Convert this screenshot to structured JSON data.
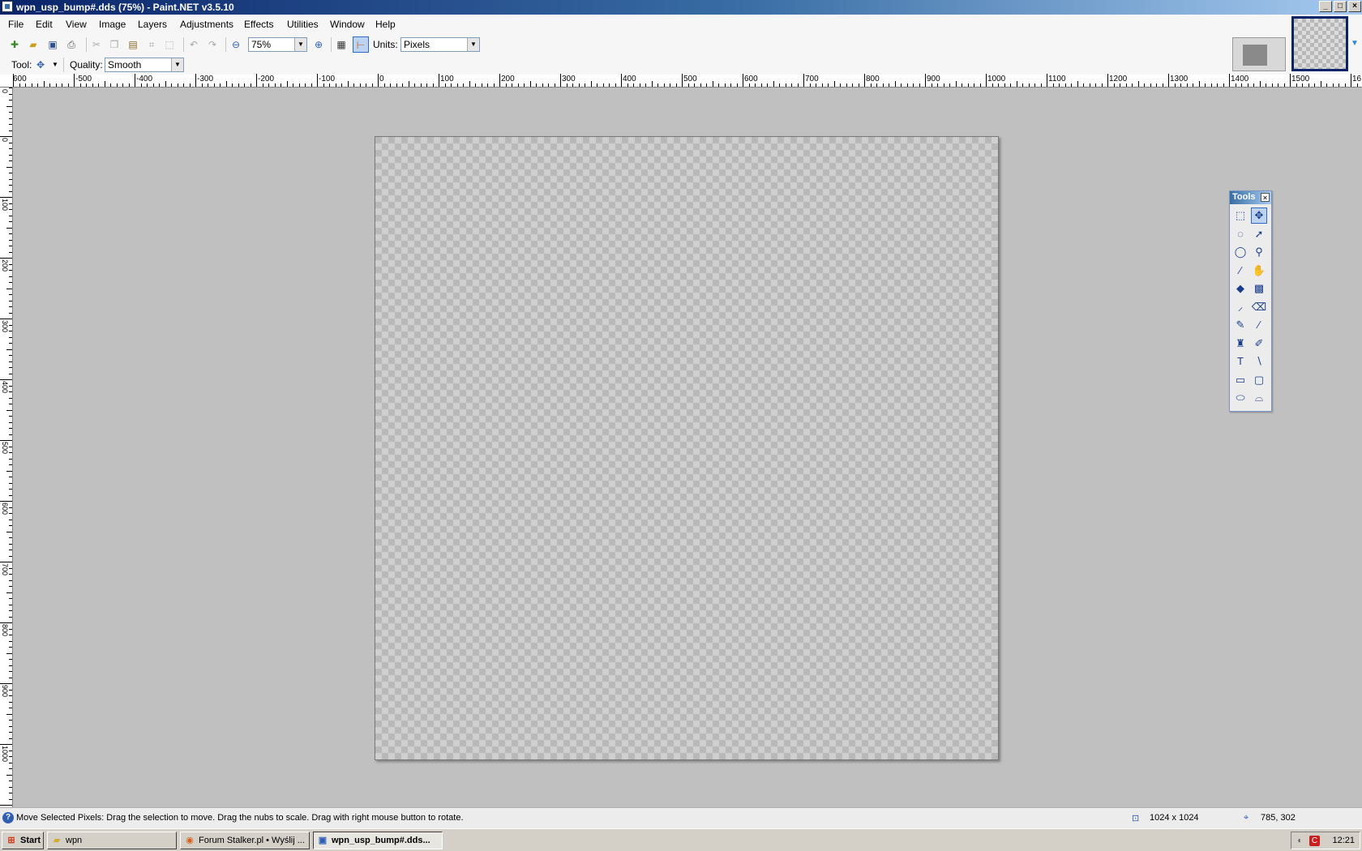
{
  "window": {
    "title": "wpn_usp_bump#.dds (75%) - Paint.NET v3.5.10",
    "buttons": {
      "minimize": "_",
      "maximize": "□",
      "close": "×"
    }
  },
  "menu": [
    "File",
    "Edit",
    "View",
    "Image",
    "Layers",
    "Adjustments",
    "Effects",
    "Utilities",
    "Window",
    "Help"
  ],
  "toolbar": {
    "zoom_value": "75%",
    "units_label": "Units:",
    "units_value": "Pixels",
    "tool_label": "Tool:",
    "quality_label": "Quality:",
    "quality_value": "Smooth"
  },
  "ruler": {
    "unit": "px",
    "h_labels": [
      "600",
      "-500",
      "-400",
      "-300",
      "-200",
      "-100",
      "0",
      "100",
      "200",
      "300",
      "400",
      "500",
      "600",
      "700",
      "800",
      "900",
      "1000",
      "1100",
      "1200",
      "1300",
      "1400",
      "1500",
      "16"
    ],
    "v_labels": [
      "0",
      "0",
      "100",
      "200",
      "300",
      "400",
      "500",
      "600",
      "700",
      "800",
      "900",
      "1000"
    ]
  },
  "tools_window": {
    "title": "Tools",
    "icons": [
      "rectangle-select-icon",
      "move-selected-pixels-icon",
      "lasso-select-icon",
      "move-selection-icon",
      "ellipse-select-icon",
      "zoom-icon",
      "magic-wand-icon",
      "pan-icon",
      "paint-bucket-icon",
      "gradient-icon",
      "paintbrush-icon",
      "eraser-icon",
      "pencil-icon",
      "color-picker-icon",
      "clone-stamp-icon",
      "recolor-icon",
      "text-icon",
      "line-curve-icon",
      "rectangle-icon",
      "rounded-rectangle-icon",
      "ellipse-icon",
      "freeform-shape-icon"
    ]
  },
  "status": {
    "help_text": "Move Selected Pixels: Drag the selection to move. Drag the nubs to scale. Drag with right mouse button to rotate.",
    "image_size": "1024 x 1024",
    "cursor_position": "785, 302"
  },
  "taskbar": {
    "start_label": "Start",
    "tasks": [
      {
        "label": "wpn",
        "icon": "folder-icon",
        "active": false
      },
      {
        "label": "Forum Stalker.pl • Wyślij ...",
        "icon": "firefox-icon",
        "active": false
      },
      {
        "label": "wpn_usp_bump#.dds...",
        "icon": "paintnet-icon",
        "active": true
      }
    ],
    "clock": "12:21"
  }
}
